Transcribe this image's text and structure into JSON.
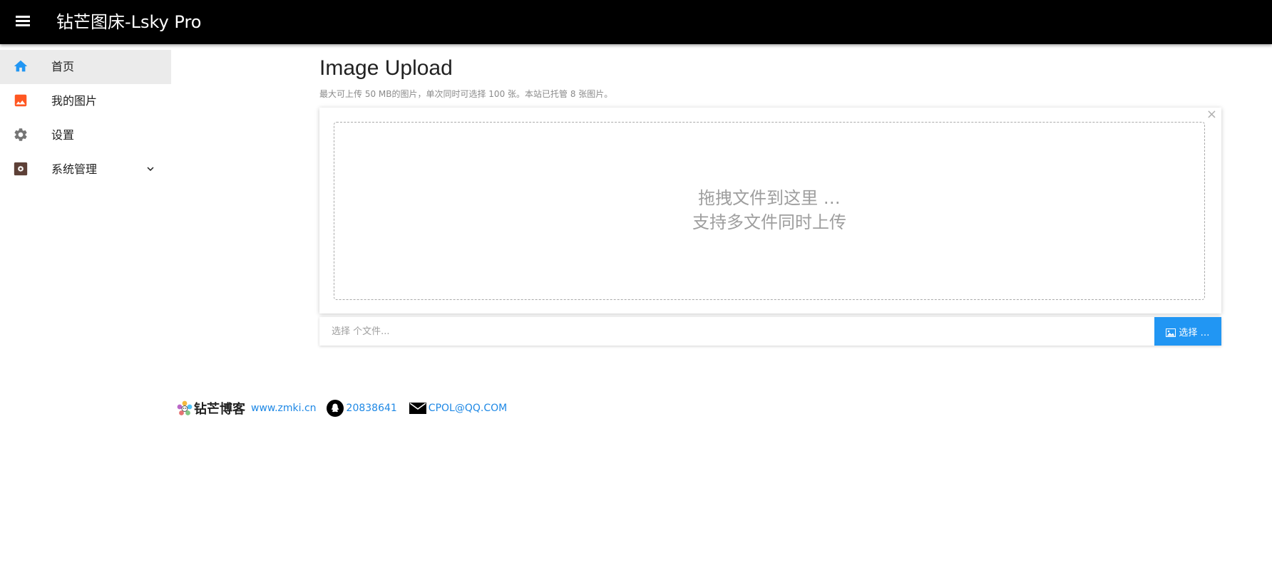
{
  "app": {
    "title": "钻芒图床-Lsky Pro"
  },
  "sidebar": {
    "items": [
      {
        "label": "首页",
        "icon": "home-icon",
        "color": "#2196f3",
        "active": true
      },
      {
        "label": "我的图片",
        "icon": "image-icon",
        "color": "#ff5722",
        "active": false
      },
      {
        "label": "设置",
        "icon": "gear-icon",
        "color": "#757575",
        "active": false
      },
      {
        "label": "系统管理",
        "icon": "admin-gear-icon",
        "color": "#5d4037",
        "active": false,
        "expandable": true
      }
    ]
  },
  "main": {
    "title": "Image Upload",
    "description": "最大可上传 50 MB的图片，单次同时可选择 100 张。本站已托管 8 张图片。",
    "dropzone": {
      "close": "×",
      "line1": "拖拽文件到这里 …",
      "line2": "支持多文件同时上传"
    },
    "file_input": {
      "placeholder": "选择 个文件..."
    },
    "choose_button": "选择 …"
  },
  "footer": {
    "logo_text": "钻芒博客",
    "site": "www.zmki.cn",
    "qq": "20838641",
    "email": "CPOL@QQ.COM"
  },
  "colors": {
    "topbar": "#000000",
    "accent": "#2196f3",
    "link": "#1e88e5"
  }
}
